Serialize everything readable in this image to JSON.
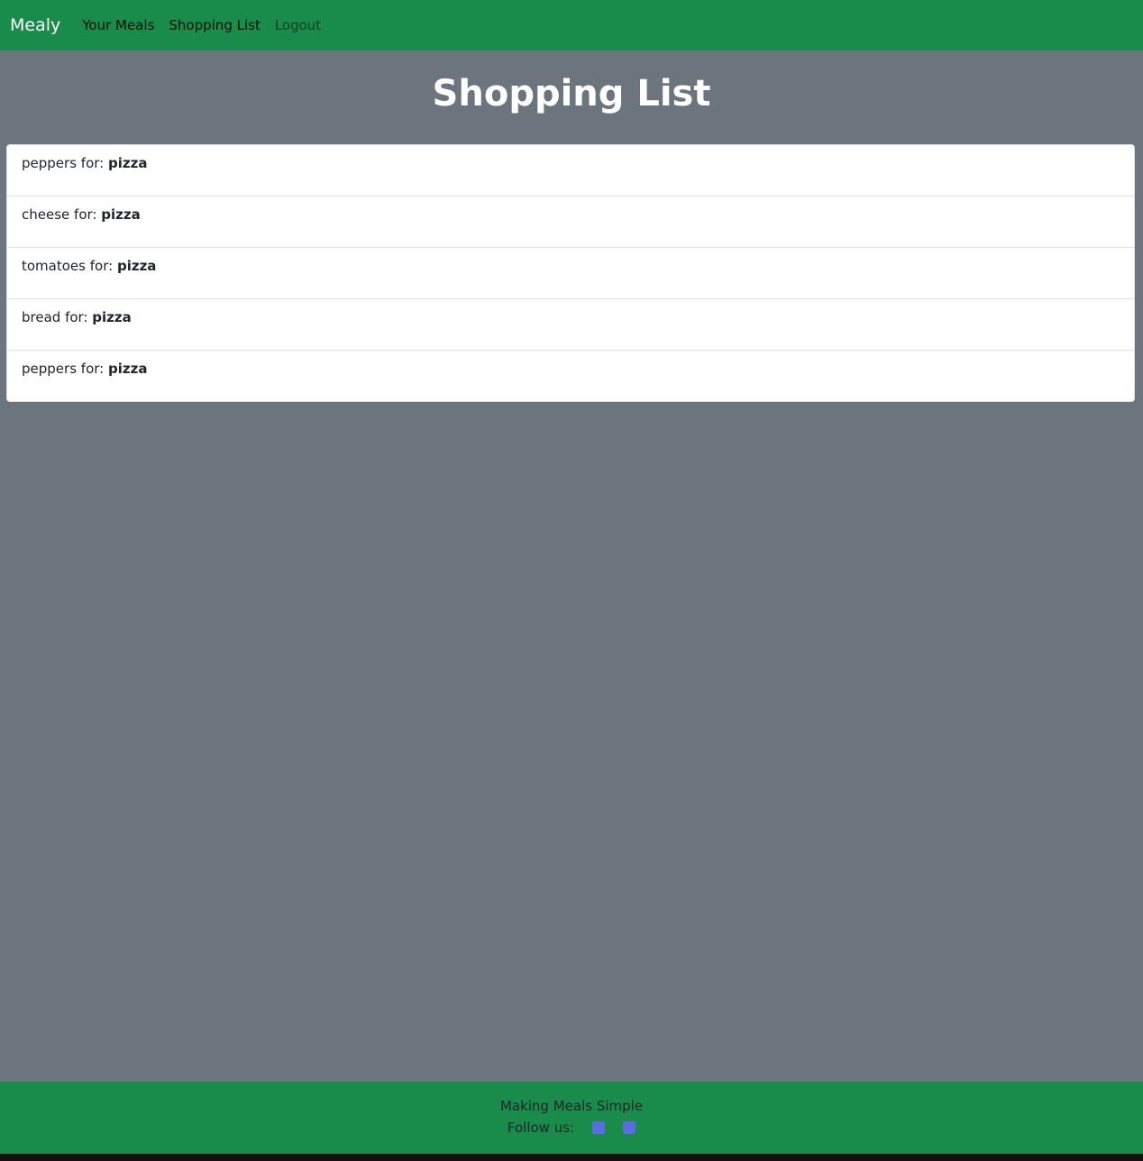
{
  "navbar": {
    "brand": "Mealy",
    "links": [
      {
        "label": "Your Meals"
      },
      {
        "label": "Shopping List"
      },
      {
        "label": "Logout"
      }
    ]
  },
  "page": {
    "title": "Shopping List"
  },
  "shopping_list": {
    "for_text": "for:",
    "items": [
      {
        "ingredient": "peppers",
        "meal": "pizza"
      },
      {
        "ingredient": "cheese",
        "meal": "pizza"
      },
      {
        "ingredient": "tomatoes",
        "meal": "pizza"
      },
      {
        "ingredient": "bread",
        "meal": "pizza"
      },
      {
        "ingredient": "peppers",
        "meal": "pizza"
      }
    ]
  },
  "footer": {
    "tagline": "Making Meals Simple",
    "follow_label": "Follow us:",
    "social_icons": [
      "facebook-icon",
      "twitter-icon"
    ]
  },
  "colors": {
    "navbar_bg": "#198c4c",
    "page_bg": "#6c757d",
    "icon_color": "#5b6be0"
  }
}
